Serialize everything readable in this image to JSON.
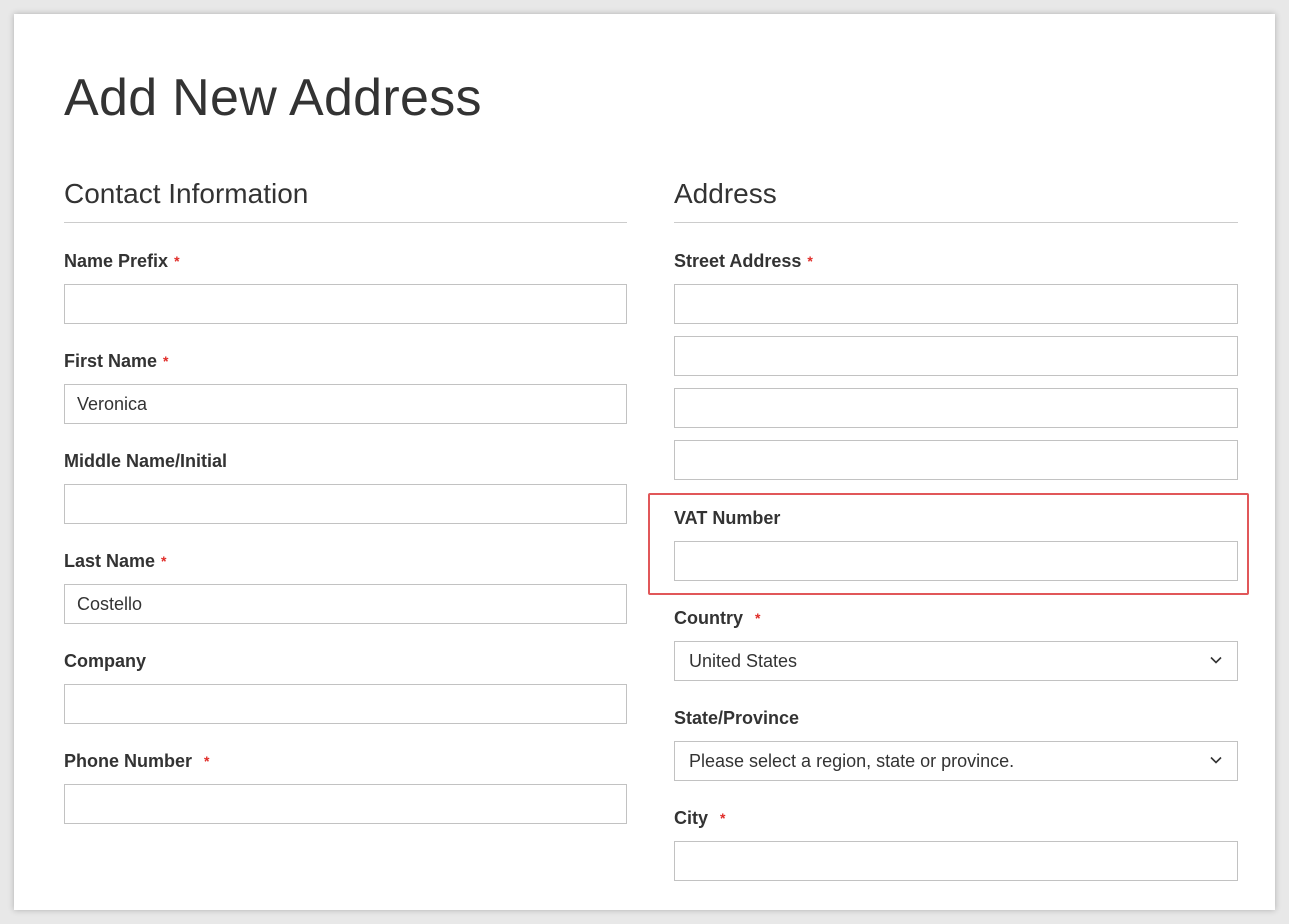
{
  "page": {
    "title": "Add New Address"
  },
  "contact": {
    "section_title": "Contact Information",
    "name_prefix": {
      "label": "Name Prefix",
      "required": "*",
      "value": ""
    },
    "first_name": {
      "label": "First Name",
      "required": "*",
      "value": "Veronica"
    },
    "middle_name": {
      "label": "Middle Name/Initial",
      "value": ""
    },
    "last_name": {
      "label": "Last Name",
      "required": "*",
      "value": "Costello"
    },
    "company": {
      "label": "Company",
      "value": ""
    },
    "phone": {
      "label": "Phone Number",
      "required": "*",
      "value": ""
    }
  },
  "address": {
    "section_title": "Address",
    "street": {
      "label": "Street Address",
      "required": "*",
      "lines": [
        "",
        "",
        "",
        ""
      ]
    },
    "vat": {
      "label": "VAT Number",
      "value": ""
    },
    "country": {
      "label": "Country",
      "required": "*",
      "selected": "United States"
    },
    "state": {
      "label": "State/Province",
      "selected": "Please select a region, state or province."
    },
    "city": {
      "label": "City",
      "required": "*",
      "value": ""
    }
  },
  "colors": {
    "required": "#e02b27",
    "highlight": "#e15759",
    "border": "#c2c2c2"
  },
  "icons": {
    "dropdown": "chevron-down-icon"
  }
}
